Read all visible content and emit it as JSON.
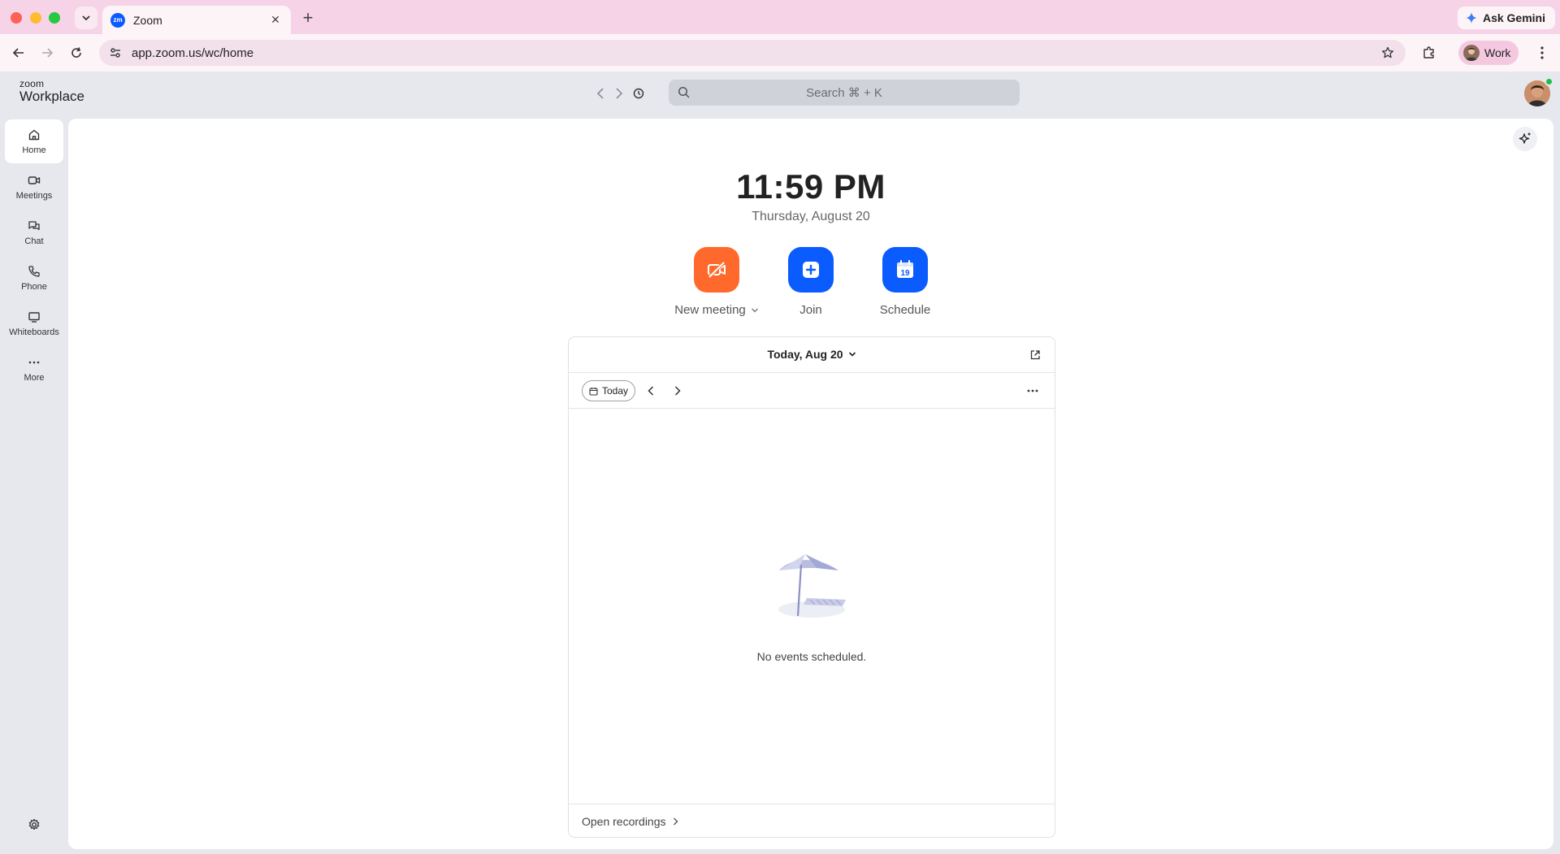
{
  "browser": {
    "tab_title": "Zoom",
    "tab_favicon_text": "zm",
    "url": "app.zoom.us/wc/home",
    "gemini_label": "Ask Gemini",
    "profile_label": "Work"
  },
  "app": {
    "brand_small": "zoom",
    "brand_big": "Workplace",
    "search_placeholder": "Search ⌘ + K"
  },
  "sidebar": {
    "items": [
      {
        "label": "Home",
        "icon": "home-icon",
        "active": true
      },
      {
        "label": "Meetings",
        "icon": "video-icon"
      },
      {
        "label": "Chat",
        "icon": "chat-icon"
      },
      {
        "label": "Phone",
        "icon": "phone-icon"
      },
      {
        "label": "Whiteboards",
        "icon": "whiteboard-icon"
      },
      {
        "label": "More",
        "icon": "more-icon"
      }
    ]
  },
  "home": {
    "time": "11:59 PM",
    "date": "Thursday, August 20",
    "actions": [
      {
        "label": "New meeting",
        "icon": "video-off-icon",
        "color": "#ff6a2c"
      },
      {
        "label": "Join",
        "icon": "plus-icon",
        "color": "#0b5cff"
      },
      {
        "label": "Schedule",
        "icon": "calendar-icon",
        "color": "#0b5cff",
        "calendar_day": "19"
      }
    ]
  },
  "calendar": {
    "title": "Today, Aug 20",
    "today_label": "Today",
    "empty_text": "No events scheduled.",
    "footer_label": "Open recordings"
  },
  "colors": {
    "accent_blue": "#0b5cff",
    "accent_orange": "#ff6a2c",
    "presence_green": "#1fbe4a"
  }
}
